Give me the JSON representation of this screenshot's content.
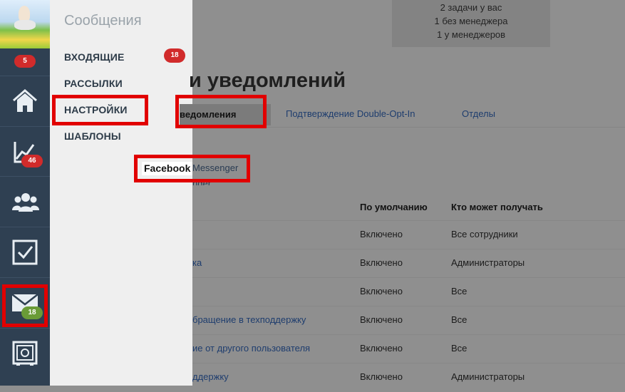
{
  "rail": {
    "top_badge": "5",
    "items": [
      {
        "icon": "home-icon"
      },
      {
        "icon": "chart-icon",
        "badge": "46"
      },
      {
        "icon": "users-icon"
      },
      {
        "icon": "tasks-icon"
      },
      {
        "icon": "mail-icon",
        "badge": "18"
      },
      {
        "icon": "safe-icon"
      }
    ]
  },
  "menu": {
    "title": "Сообщения",
    "items": [
      {
        "label": "ВХОДЯЩИЕ",
        "badge": "18"
      },
      {
        "label": "РАССЫЛКИ"
      },
      {
        "label": "НАСТРОЙКИ"
      },
      {
        "label": "ШАБЛОНЫ"
      }
    ]
  },
  "info": {
    "lines": [
      "2 задачи у вас",
      "1 без менеджера",
      "1 у менеджеров"
    ]
  },
  "page": {
    "title_fragment": "и уведомлений",
    "tabs": {
      "active_fragment": "ведомления",
      "double_opt_in": "Подтверждение Double-Opt-In",
      "departments": "Отделы"
    },
    "facebook_tag": "Facebook",
    "facebook_link_rest": "Messenger",
    "facebook_cut": "nger"
  },
  "table": {
    "headers": {
      "default": "По умолчанию",
      "who": "Кто может получать"
    },
    "rows": [
      {
        "name": "",
        "default": "Включено",
        "who": "Все сотрудники"
      },
      {
        "name": "ка",
        "default": "Включено",
        "who": "Администраторы"
      },
      {
        "name": "",
        "default": "Включено",
        "who": "Все"
      },
      {
        "name": "бращение в техподдержку",
        "default": "Включено",
        "who": "Все"
      },
      {
        "name": "ие от другого пользователя",
        "default": "Включено",
        "who": "Все"
      },
      {
        "name": "ддержку",
        "default": "Включено",
        "who": "Администраторы"
      }
    ]
  },
  "colors": {
    "highlight": "#e10000",
    "rail_bg": "#2f4052",
    "badge_red": "#d12b2b",
    "badge_green": "#6a9b37"
  }
}
